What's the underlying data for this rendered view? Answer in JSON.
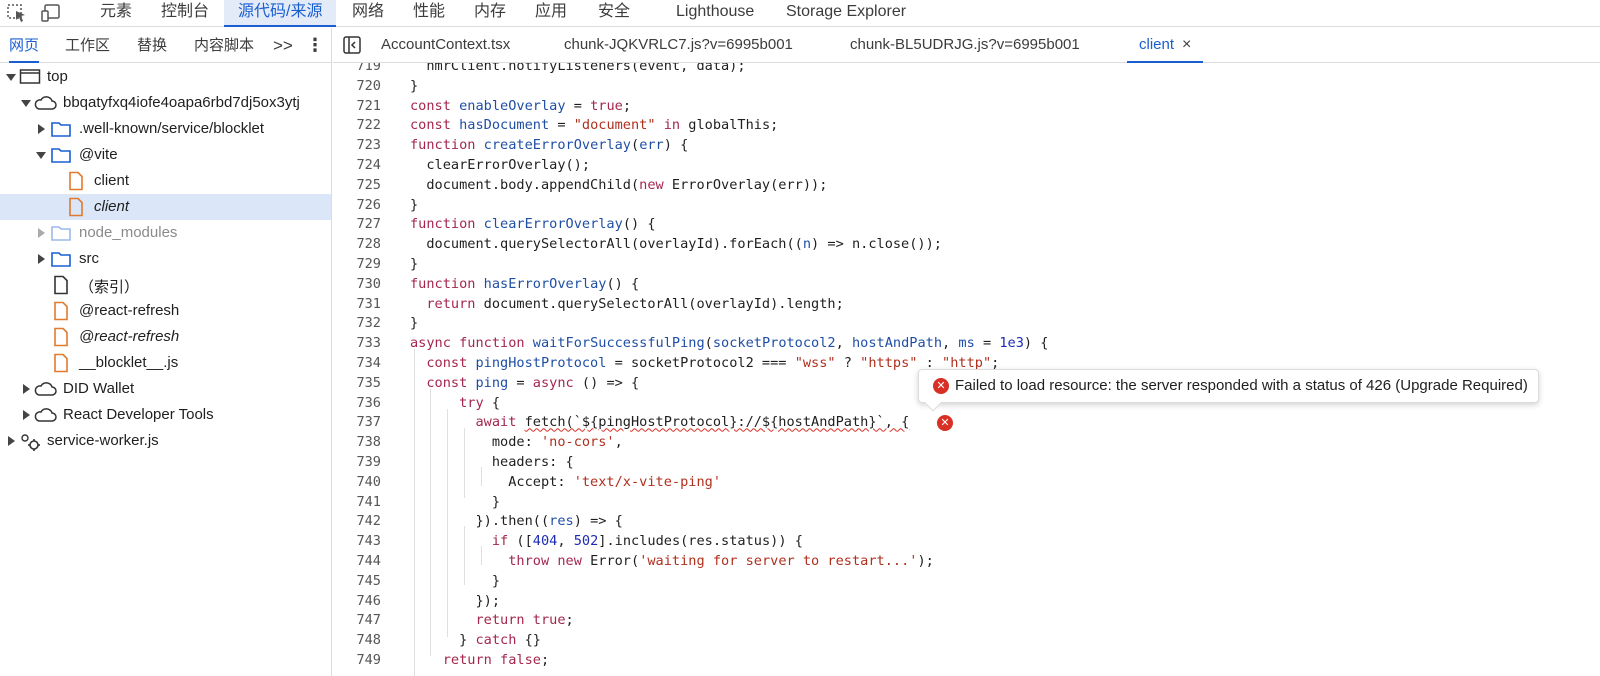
{
  "toolbar": {
    "tabs": [
      "元素",
      "控制台",
      "源代码/来源",
      "网络",
      "性能",
      "内存",
      "应用",
      "安全",
      "Lighthouse",
      "Storage Explorer"
    ],
    "active_tab": "源代码/来源",
    "icons": [
      "inspect-element-icon",
      "device-toolbar-icon"
    ]
  },
  "sidebar": {
    "tabs": [
      "网页",
      "工作区",
      "替换",
      "内容脚本"
    ],
    "more": ">>",
    "menu": "⋮",
    "tree": [
      {
        "label": "top",
        "icon": "frame-icon",
        "expanded": true
      },
      {
        "label": "bbqatyfxq4iofe4oapa6rbd7dj5ox3ytj",
        "icon": "cloud-icon",
        "expanded": true
      },
      {
        "label": ".well-known/service/blocklet",
        "icon": "folder-icon",
        "expanded": false
      },
      {
        "label": "@vite",
        "icon": "folder-icon",
        "expanded": true
      },
      {
        "label": "client",
        "icon": "file-icon"
      },
      {
        "label": "client",
        "icon": "file-icon",
        "selected": true
      },
      {
        "label": "node_modules",
        "icon": "folder-icon",
        "expanded": false
      },
      {
        "label": "src",
        "icon": "folder-icon",
        "expanded": false
      },
      {
        "label": "（索引）",
        "icon": "document-icon"
      },
      {
        "label": "@react-refresh",
        "icon": "file-icon"
      },
      {
        "label": "@react-refresh",
        "icon": "file-icon"
      },
      {
        "label": "__blocklet__.js",
        "icon": "file-icon"
      },
      {
        "label": "DID Wallet",
        "icon": "cloud-icon",
        "expanded": false
      },
      {
        "label": "React Developer Tools",
        "icon": "cloud-icon",
        "expanded": false
      },
      {
        "label": "service-worker.js",
        "icon": "gear-icon",
        "expanded": false
      }
    ]
  },
  "editor": {
    "tabs": [
      "AccountContext.tsx",
      "chunk-JQKVRLC7.js?v=6995b001",
      "chunk-BL5UDRJG.js?v=6995b001",
      "client"
    ],
    "active_tab": "client",
    "close": "×",
    "line_numbers": [
      "719",
      "720",
      "721",
      "722",
      "723",
      "724",
      "725",
      "726",
      "727",
      "728",
      "729",
      "730",
      "731",
      "732",
      "733",
      "734",
      "735",
      "736",
      "737",
      "738",
      "739",
      "740",
      "741",
      "742",
      "743",
      "744",
      "745",
      "746",
      "747",
      "748",
      "749"
    ]
  },
  "error_tooltip": {
    "message": "Failed to load resource: the server responded with a status of 426 (Upgrade Required)",
    "icon": "error-icon"
  },
  "colors": {
    "accent": "#1a5fd0",
    "keyword": "#a5274e",
    "function": "#1f4fa5",
    "string": "#b0301e",
    "number": "#1c2bb4",
    "error": "#d93025",
    "selected_row": "#dbe6f9"
  }
}
